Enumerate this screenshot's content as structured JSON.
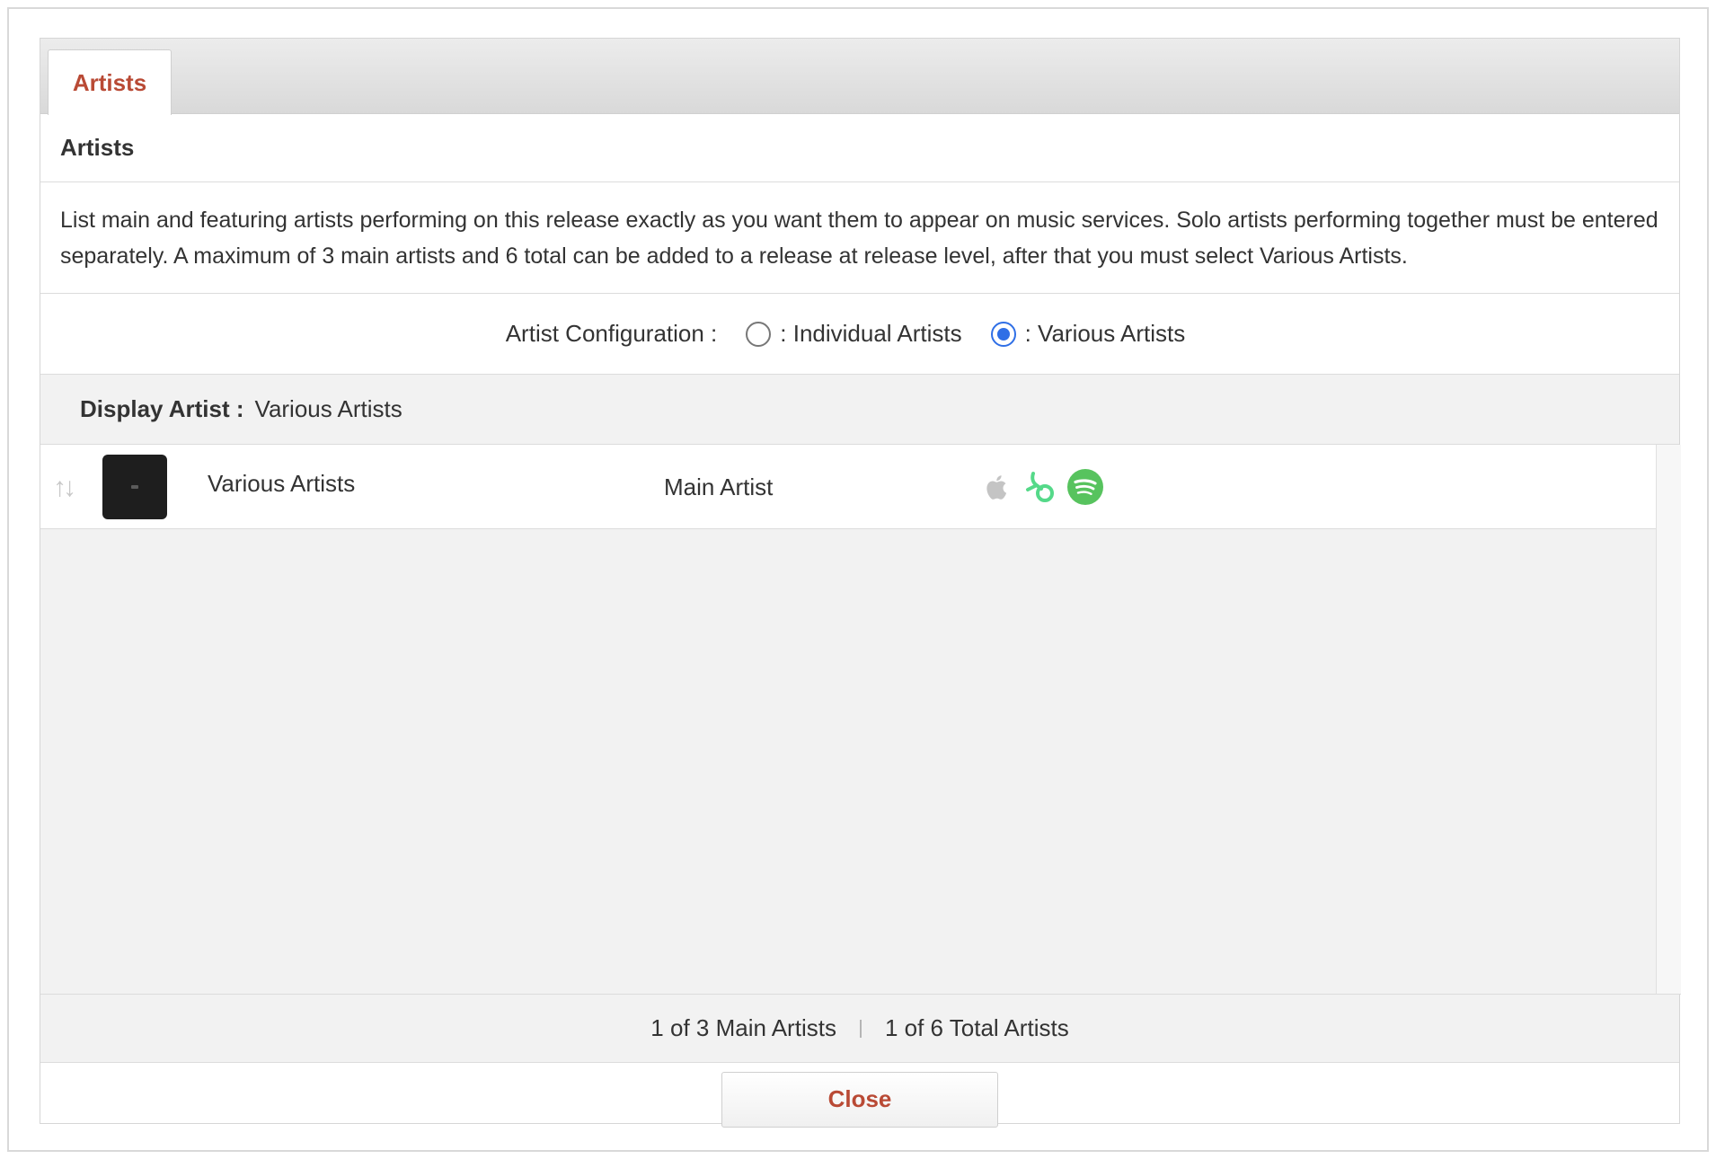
{
  "tabs": [
    {
      "label": "Artists",
      "active": true
    }
  ],
  "section": {
    "title": "Artists"
  },
  "description": "List main and featuring artists performing on this release exactly as you want them to appear on music services. Solo artists performing together must be entered separately. A maximum of 3 main artists and 6 total can be added to a release at release level, after that you must select Various Artists.",
  "config": {
    "label": "Artist Configuration :",
    "options": [
      {
        "label": ": Individual Artists",
        "checked": false
      },
      {
        "label": ": Various Artists",
        "checked": true
      }
    ]
  },
  "display_artist": {
    "label": "Display Artist :",
    "value": "Various Artists"
  },
  "artists": [
    {
      "name": "Various Artists",
      "role": "Main Artist",
      "services": [
        "apple-music-icon",
        "beatport-icon",
        "spotify-icon"
      ]
    }
  ],
  "counts": {
    "main": "1 of 3 Main Artists",
    "total": "1 of 6 Total Artists"
  },
  "actions": {
    "close_label": "Close"
  },
  "colors": {
    "accent": "#b94a35",
    "radio": "#2f6fe6",
    "spotify": "#57c35e",
    "beatport": "#55d989",
    "apple": "#c4c4c4"
  }
}
